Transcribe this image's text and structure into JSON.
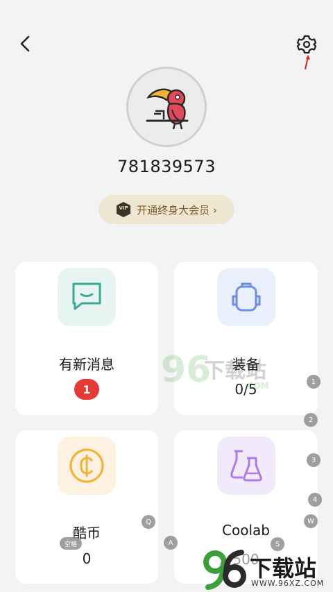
{
  "header": {
    "back_icon": "chevron-left-icon",
    "settings_icon": "gear-icon"
  },
  "profile": {
    "avatar_icon": "toucan-avatar",
    "user_id": "781839573",
    "vip_label": "开通终身大会员 ›",
    "vip_badge_text": "VIP"
  },
  "cards": {
    "messages": {
      "title": "有新消息",
      "badge": "1",
      "icon": "chat-bubble-icon",
      "tile_color": "#e6f5f2"
    },
    "equipment": {
      "title": "装备",
      "value": "0/5",
      "icon": "backpack-icon",
      "tile_color": "#eaf0fb"
    },
    "coins": {
      "title": "酷币",
      "value": "0",
      "icon": "coin-icon",
      "tile_color": "#fdf2e2"
    },
    "coolab": {
      "title": "Coolab",
      "value": "500",
      "icon": "flask-icon",
      "tile_color": "#f1eafb"
    }
  },
  "overlay_keys": {
    "numbers": [
      "1",
      "2",
      "3",
      "4"
    ],
    "letters": [
      "Q",
      "W",
      "A",
      "S"
    ],
    "space": "空格"
  },
  "watermark": {
    "number": "96",
    "text": "下载站",
    "url": ".COM",
    "corner_text": "下载站",
    "corner_url": "WWW.96XZ.COM"
  },
  "colors": {
    "accent_red": "#e53935",
    "vip_text": "#7a5a26",
    "background": "#f3f3f3"
  }
}
